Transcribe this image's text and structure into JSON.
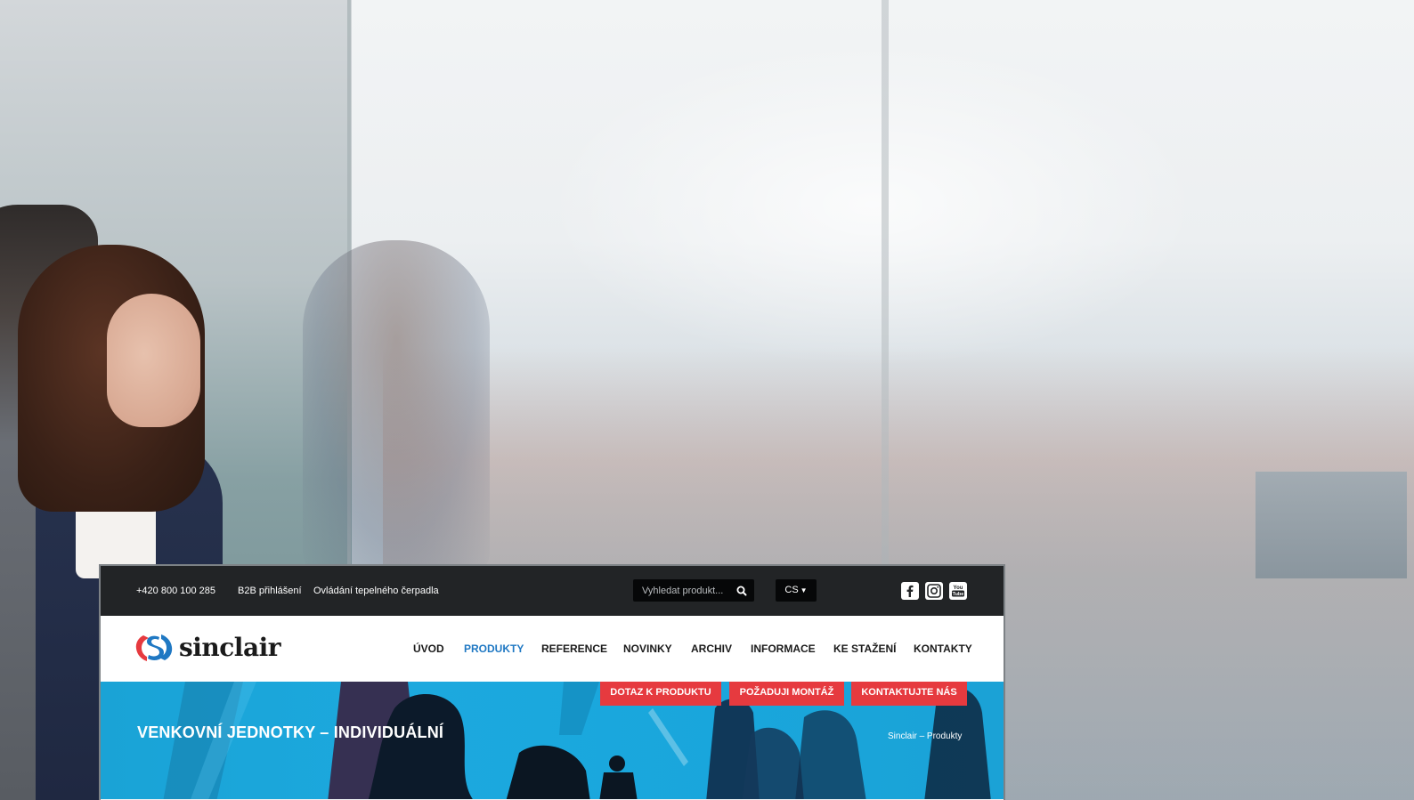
{
  "topbar": {
    "phone": "+420 800 100 285",
    "b2b_login": "B2B přihlášení",
    "heat_pump_control": "Ovládání tepelného čerpadla",
    "search": {
      "placeholder": "Vyhledat produkt..."
    },
    "language": "CS"
  },
  "social": [
    "facebook-icon",
    "instagram-icon",
    "youtube-icon"
  ],
  "logo": {
    "text": "sinclair"
  },
  "nav": {
    "items": [
      {
        "label": "ÚVOD"
      },
      {
        "label": "PRODUKTY"
      },
      {
        "label": "REFERENCE"
      },
      {
        "label": "NOVINKY"
      },
      {
        "label": "ARCHIV"
      },
      {
        "label": "INFORMACE"
      },
      {
        "label": "KE STAŽENÍ"
      },
      {
        "label": "KONTAKTY"
      }
    ],
    "active": "PRODUKTY"
  },
  "hero": {
    "title": "VENKOVNÍ JEDNOTKY – INDIVIDUÁLNÍ",
    "breadcrumb": "Sinclair – Produkty",
    "cta": [
      "DOTAZ K PRODUKTU",
      "POŽADUJI MONTÁŽ",
      "KONTAKTUJTE NÁS"
    ]
  },
  "colors": {
    "accent_red": "#e63a3f",
    "active_blue": "#1f78c3",
    "hero_blue": "#1ca9de",
    "topbar_dark": "#222426"
  }
}
